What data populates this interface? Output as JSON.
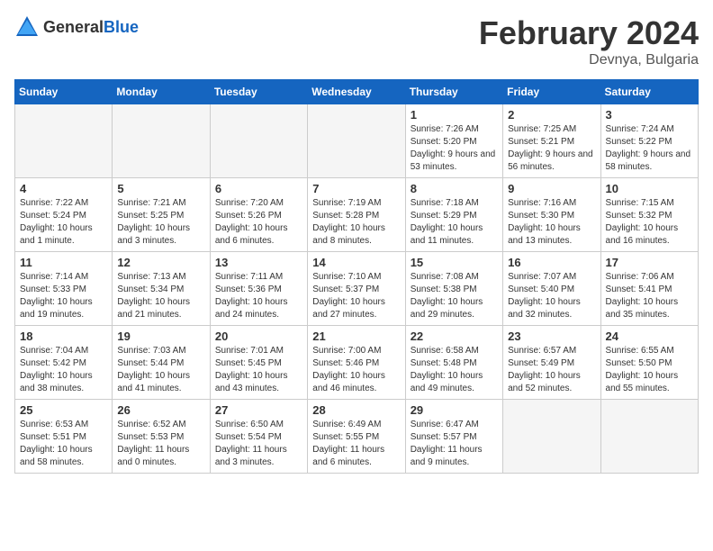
{
  "logo": {
    "text_general": "General",
    "text_blue": "Blue"
  },
  "title": "February 2024",
  "location": "Devnya, Bulgaria",
  "days_of_week": [
    "Sunday",
    "Monday",
    "Tuesday",
    "Wednesday",
    "Thursday",
    "Friday",
    "Saturday"
  ],
  "weeks": [
    [
      {
        "day": "",
        "empty": true
      },
      {
        "day": "",
        "empty": true
      },
      {
        "day": "",
        "empty": true
      },
      {
        "day": "",
        "empty": true
      },
      {
        "day": "1",
        "sunrise": "7:26 AM",
        "sunset": "5:20 PM",
        "daylight": "9 hours and 53 minutes."
      },
      {
        "day": "2",
        "sunrise": "7:25 AM",
        "sunset": "5:21 PM",
        "daylight": "9 hours and 56 minutes."
      },
      {
        "day": "3",
        "sunrise": "7:24 AM",
        "sunset": "5:22 PM",
        "daylight": "9 hours and 58 minutes."
      }
    ],
    [
      {
        "day": "4",
        "sunrise": "7:22 AM",
        "sunset": "5:24 PM",
        "daylight": "10 hours and 1 minute."
      },
      {
        "day": "5",
        "sunrise": "7:21 AM",
        "sunset": "5:25 PM",
        "daylight": "10 hours and 3 minutes."
      },
      {
        "day": "6",
        "sunrise": "7:20 AM",
        "sunset": "5:26 PM",
        "daylight": "10 hours and 6 minutes."
      },
      {
        "day": "7",
        "sunrise": "7:19 AM",
        "sunset": "5:28 PM",
        "daylight": "10 hours and 8 minutes."
      },
      {
        "day": "8",
        "sunrise": "7:18 AM",
        "sunset": "5:29 PM",
        "daylight": "10 hours and 11 minutes."
      },
      {
        "day": "9",
        "sunrise": "7:16 AM",
        "sunset": "5:30 PM",
        "daylight": "10 hours and 13 minutes."
      },
      {
        "day": "10",
        "sunrise": "7:15 AM",
        "sunset": "5:32 PM",
        "daylight": "10 hours and 16 minutes."
      }
    ],
    [
      {
        "day": "11",
        "sunrise": "7:14 AM",
        "sunset": "5:33 PM",
        "daylight": "10 hours and 19 minutes."
      },
      {
        "day": "12",
        "sunrise": "7:13 AM",
        "sunset": "5:34 PM",
        "daylight": "10 hours and 21 minutes."
      },
      {
        "day": "13",
        "sunrise": "7:11 AM",
        "sunset": "5:36 PM",
        "daylight": "10 hours and 24 minutes."
      },
      {
        "day": "14",
        "sunrise": "7:10 AM",
        "sunset": "5:37 PM",
        "daylight": "10 hours and 27 minutes."
      },
      {
        "day": "15",
        "sunrise": "7:08 AM",
        "sunset": "5:38 PM",
        "daylight": "10 hours and 29 minutes."
      },
      {
        "day": "16",
        "sunrise": "7:07 AM",
        "sunset": "5:40 PM",
        "daylight": "10 hours and 32 minutes."
      },
      {
        "day": "17",
        "sunrise": "7:06 AM",
        "sunset": "5:41 PM",
        "daylight": "10 hours and 35 minutes."
      }
    ],
    [
      {
        "day": "18",
        "sunrise": "7:04 AM",
        "sunset": "5:42 PM",
        "daylight": "10 hours and 38 minutes."
      },
      {
        "day": "19",
        "sunrise": "7:03 AM",
        "sunset": "5:44 PM",
        "daylight": "10 hours and 41 minutes."
      },
      {
        "day": "20",
        "sunrise": "7:01 AM",
        "sunset": "5:45 PM",
        "daylight": "10 hours and 43 minutes."
      },
      {
        "day": "21",
        "sunrise": "7:00 AM",
        "sunset": "5:46 PM",
        "daylight": "10 hours and 46 minutes."
      },
      {
        "day": "22",
        "sunrise": "6:58 AM",
        "sunset": "5:48 PM",
        "daylight": "10 hours and 49 minutes."
      },
      {
        "day": "23",
        "sunrise": "6:57 AM",
        "sunset": "5:49 PM",
        "daylight": "10 hours and 52 minutes."
      },
      {
        "day": "24",
        "sunrise": "6:55 AM",
        "sunset": "5:50 PM",
        "daylight": "10 hours and 55 minutes."
      }
    ],
    [
      {
        "day": "25",
        "sunrise": "6:53 AM",
        "sunset": "5:51 PM",
        "daylight": "10 hours and 58 minutes."
      },
      {
        "day": "26",
        "sunrise": "6:52 AM",
        "sunset": "5:53 PM",
        "daylight": "11 hours and 0 minutes."
      },
      {
        "day": "27",
        "sunrise": "6:50 AM",
        "sunset": "5:54 PM",
        "daylight": "11 hours and 3 minutes."
      },
      {
        "day": "28",
        "sunrise": "6:49 AM",
        "sunset": "5:55 PM",
        "daylight": "11 hours and 6 minutes."
      },
      {
        "day": "29",
        "sunrise": "6:47 AM",
        "sunset": "5:57 PM",
        "daylight": "11 hours and 9 minutes."
      },
      {
        "day": "",
        "empty": true
      },
      {
        "day": "",
        "empty": true
      }
    ]
  ],
  "labels": {
    "sunrise": "Sunrise:",
    "sunset": "Sunset:",
    "daylight": "Daylight:"
  }
}
